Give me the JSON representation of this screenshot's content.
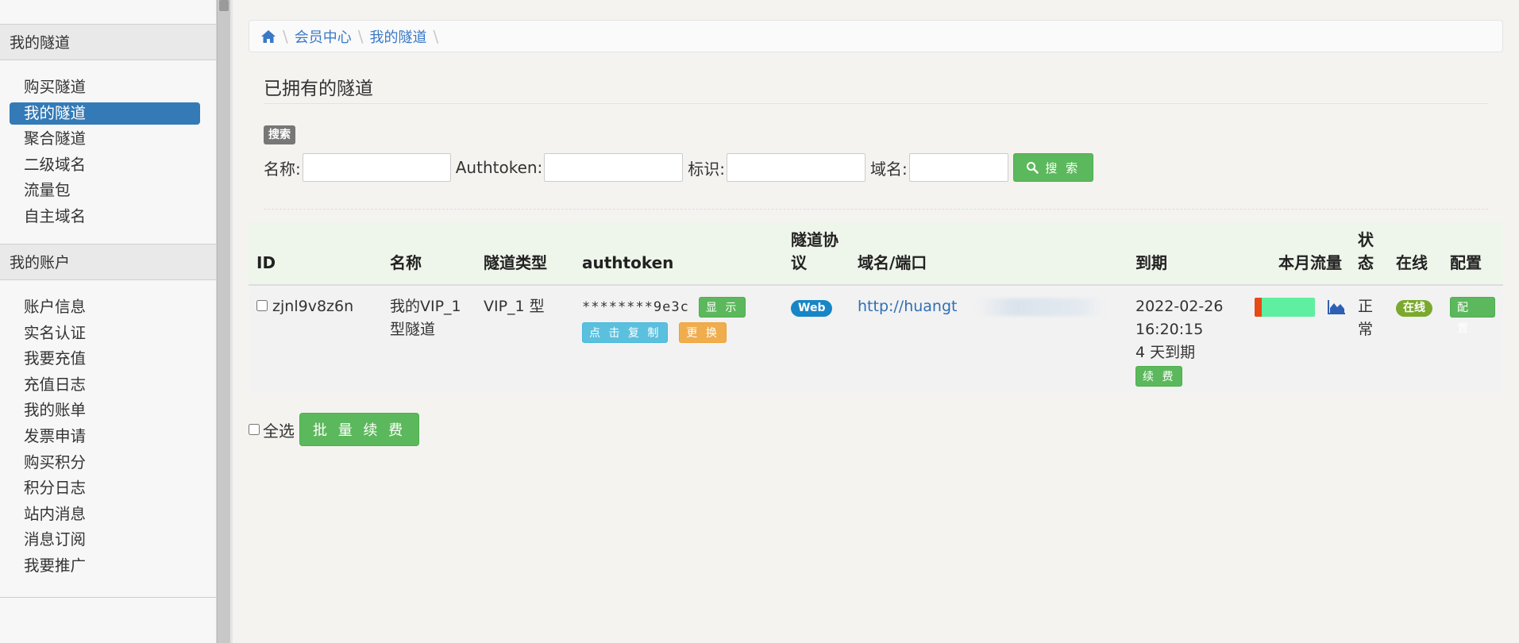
{
  "sidebar": {
    "tunnel_group": {
      "title": "我的隧道",
      "items": [
        {
          "label": "购买隧道"
        },
        {
          "label": "我的隧道"
        },
        {
          "label": "聚合隧道"
        },
        {
          "label": "二级域名"
        },
        {
          "label": "流量包"
        },
        {
          "label": "自主域名"
        }
      ]
    },
    "account_group": {
      "title": "我的账户",
      "items": [
        {
          "label": "账户信息"
        },
        {
          "label": "实名认证"
        },
        {
          "label": "我要充值"
        },
        {
          "label": "充值日志"
        },
        {
          "label": "我的账单"
        },
        {
          "label": "发票申请"
        },
        {
          "label": "购买积分"
        },
        {
          "label": "积分日志"
        },
        {
          "label": "站内消息"
        },
        {
          "label": "消息订阅"
        },
        {
          "label": "我要推广"
        }
      ]
    }
  },
  "breadcrumb": {
    "items": [
      "会员中心",
      "我的隧道"
    ],
    "home_icon": "home-icon"
  },
  "page": {
    "title": "已拥有的隧道",
    "search_badge": "搜索"
  },
  "search": {
    "name_label": "名称:",
    "authtoken_label": "Authtoken:",
    "tag_label": "标识:",
    "domain_label": "域名:",
    "button_label": "搜 索",
    "button_icon": "search-icon"
  },
  "table": {
    "headers": {
      "id": "ID",
      "name": "名称",
      "type": "隧道类型",
      "authtoken": "authtoken",
      "protocol": "隧道协议",
      "domain": "域名/端口",
      "expire": "到期",
      "traffic": "本月流量",
      "status": "状态",
      "online": "在线",
      "config": "配置"
    },
    "rows": [
      {
        "id": "zjnl9v8z6n",
        "name": "我的VIP_1型隧道",
        "type": "VIP_1 型",
        "authtoken": "********9e3c",
        "show_button": "显 示",
        "copy_button": "点 击 复 制",
        "change_button": "更 换",
        "protocol": "Web",
        "domain": "http://huangt",
        "expire_date": "2022-02-26",
        "expire_time": "16:20:15",
        "expire_remaining": "4 天到期",
        "renew_button": "续 费",
        "traffic_used_fraction": 0.12,
        "traffic_icon": "area-chart-icon",
        "status": "正常",
        "online": "在线",
        "config_button": "配 置"
      }
    ]
  },
  "bottom": {
    "select_all_label": "全选",
    "batch_renew_label": "批 量 续 费"
  },
  "colors": {
    "primary": "#337ab7",
    "success": "#5cb85c",
    "info": "#5bc0de",
    "warning": "#f0ad4e",
    "header_bg": "#eef5ea",
    "traffic_remaining": "#5ef0a0",
    "traffic_used": "#e64a19"
  }
}
